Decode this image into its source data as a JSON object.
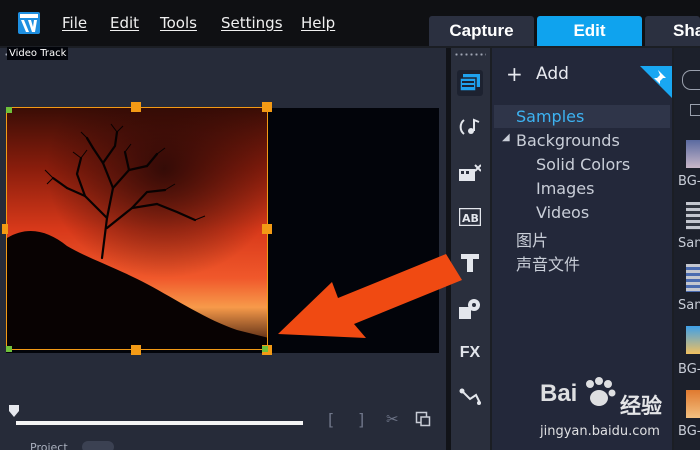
{
  "menu": {
    "file": "File",
    "edit": "Edit",
    "tools": "Tools",
    "settings": "Settings",
    "help": "Help"
  },
  "tabs": [
    {
      "label": "Capture",
      "active": false
    },
    {
      "label": "Edit",
      "active": true
    },
    {
      "label": "Sha",
      "active": false
    }
  ],
  "preview": {
    "track_label": "Video Track",
    "project_label": "Project"
  },
  "library": {
    "add_label": "Add",
    "tree": [
      {
        "label": "Samples",
        "selected": true
      },
      {
        "label": "Backgrounds",
        "expanded": true
      },
      {
        "label": "Solid Colors"
      },
      {
        "label": "Images"
      },
      {
        "label": "Videos"
      },
      {
        "label": "图片"
      },
      {
        "label": "声音文件"
      }
    ]
  },
  "thumbnails": [
    {
      "label": "BG-"
    },
    {
      "label": "Sam"
    },
    {
      "label": "Sam"
    },
    {
      "label": "BG-"
    },
    {
      "label": "BG-"
    }
  ],
  "sidebar_icons": [
    {
      "name": "media-library-icon",
      "active": true
    },
    {
      "name": "audio-icon"
    },
    {
      "name": "transition-icon"
    },
    {
      "name": "title-ab-icon"
    },
    {
      "name": "text-title-icon"
    },
    {
      "name": "graphics-icon"
    },
    {
      "name": "fx-filter-icon"
    },
    {
      "name": "path-motion-icon"
    }
  ],
  "sidebar_fx_label": "FX",
  "watermark": {
    "brand": "Bai",
    "brand2": "经验",
    "url": "jingyan.baidu.com"
  },
  "colors": {
    "accent": "#0fa3ee",
    "selection": "#3db3f2",
    "handle": "#f39a15",
    "arrow": "#f04a12"
  }
}
